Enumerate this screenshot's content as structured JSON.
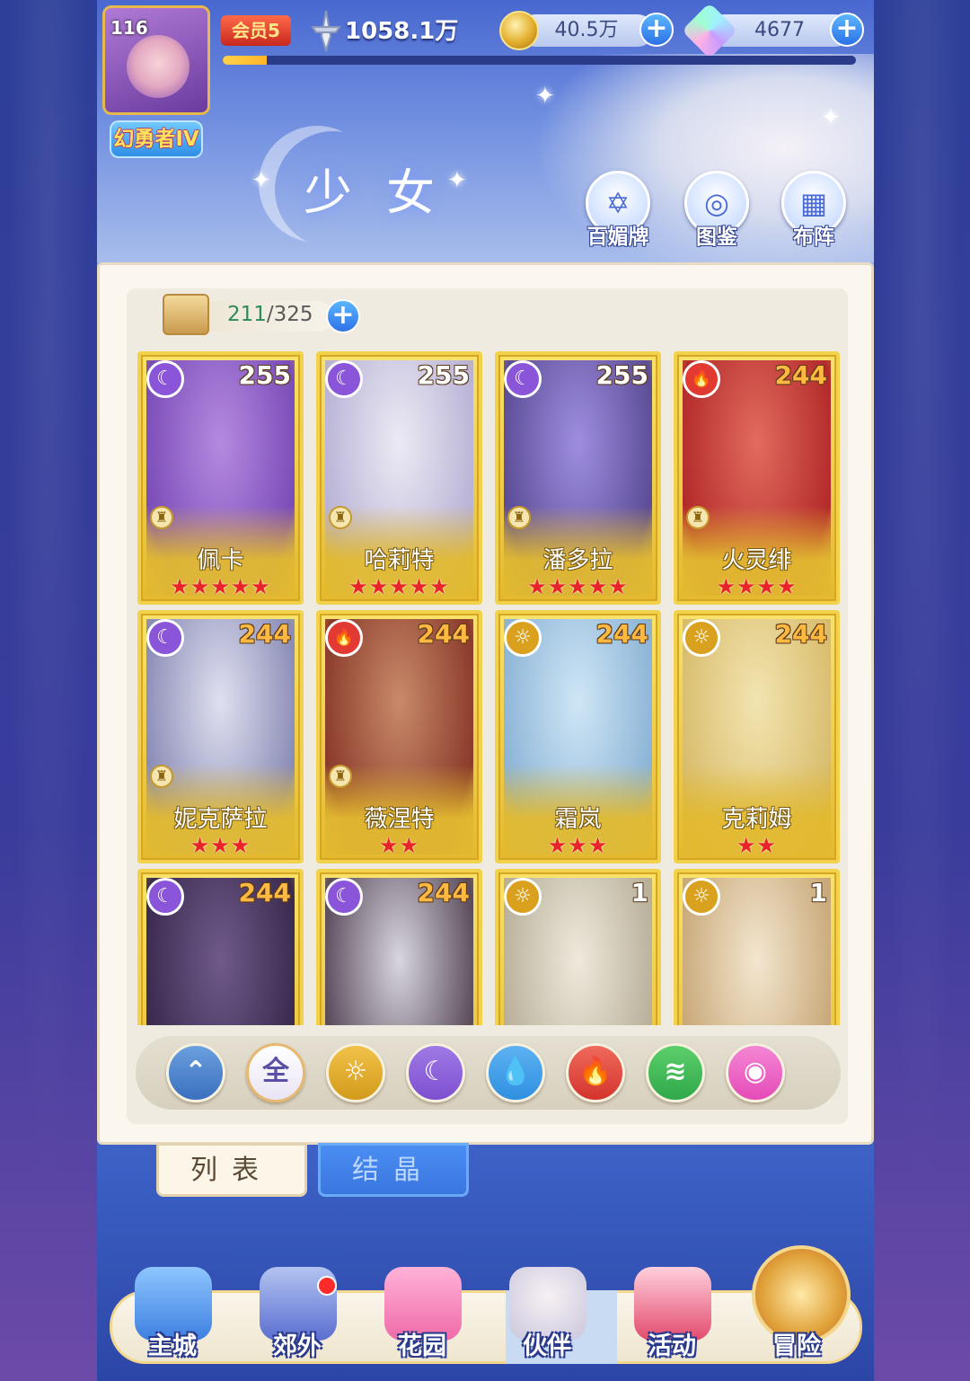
{
  "player": {
    "level": "116",
    "title": "幻勇者IV",
    "vip": "会员5",
    "power": "1058.1万",
    "exp_fraction": 0.07
  },
  "resources": {
    "gold": "40.5万",
    "gems": "4677"
  },
  "page_title": "少女",
  "header_buttons": [
    {
      "label": "百媚牌",
      "icon": "card-icon"
    },
    {
      "label": "图鉴",
      "icon": "book-icon"
    },
    {
      "label": "布阵",
      "icon": "grid-icon"
    }
  ],
  "capacity": {
    "current": "211",
    "max": "325",
    "sep": "/"
  },
  "cards": [
    {
      "name": "佩卡",
      "level": "255",
      "element": "moon",
      "stars": 5
    },
    {
      "name": "哈莉特",
      "level": "255",
      "element": "moon",
      "stars": 5
    },
    {
      "name": "潘多拉",
      "level": "255",
      "element": "moon",
      "stars": 5
    },
    {
      "name": "火灵绯",
      "level": "244",
      "element": "fire",
      "stars": 4
    },
    {
      "name": "妮克萨拉",
      "level": "244",
      "element": "moon",
      "stars": 3
    },
    {
      "name": "薇涅特",
      "level": "244",
      "element": "fire",
      "stars": 2
    },
    {
      "name": "霜岚",
      "level": "244",
      "element": "sun",
      "stars": 3
    },
    {
      "name": "克莉姆",
      "level": "244",
      "element": "sun",
      "stars": 2
    },
    {
      "name": "",
      "level": "244",
      "element": "moon",
      "stars": 0
    },
    {
      "name": "",
      "level": "244",
      "element": "moon",
      "stars": 0
    },
    {
      "name": "",
      "level": "1",
      "element": "sun",
      "stars": 0
    },
    {
      "name": "",
      "level": "1",
      "element": "sun",
      "stars": 0
    }
  ],
  "filters": [
    {
      "icon": "sort-icon",
      "label": ""
    },
    {
      "icon": "all-icon",
      "label": "全"
    },
    {
      "icon": "sun-icon",
      "label": ""
    },
    {
      "icon": "moon-icon",
      "label": ""
    },
    {
      "icon": "water-icon",
      "label": ""
    },
    {
      "icon": "fire-icon",
      "label": ""
    },
    {
      "icon": "wind-icon",
      "label": ""
    },
    {
      "icon": "arcane-icon",
      "label": ""
    }
  ],
  "tabs": {
    "list": "列表",
    "crystal": "结晶"
  },
  "nav": [
    {
      "label": "主城",
      "icon": "castle-icon"
    },
    {
      "label": "郊外",
      "icon": "outskirts-icon"
    },
    {
      "label": "花园",
      "icon": "garden-icon"
    },
    {
      "label": "伙伴",
      "icon": "partner-icon"
    },
    {
      "label": "活动",
      "icon": "gift-icon"
    },
    {
      "label": "冒险",
      "icon": "compass-icon"
    }
  ],
  "colors": {
    "moon": "#8a55d8",
    "fire": "#e23a32",
    "sun": "#d9a11e",
    "water": "#2e8fe0",
    "wind": "#2fa84a",
    "arcane": "#e54bb7",
    "card_gold": "#f2d24a"
  }
}
